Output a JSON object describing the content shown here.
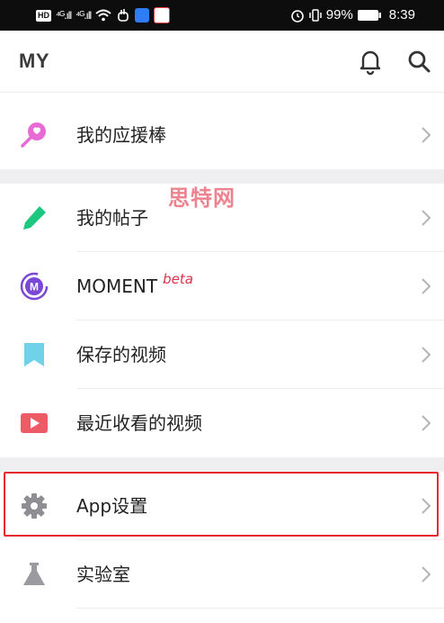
{
  "status_bar": {
    "hd_badge": "HD",
    "signal1": "⁴ᴳ.ıll",
    "signal2": "⁴ᴳ.ıll",
    "battery": "99%",
    "time": "8:39"
  },
  "header": {
    "title": "MY"
  },
  "watermark": "思特网",
  "menu": {
    "cheer_stick": "我的应援棒",
    "my_posts": "我的帖子",
    "moment": "MOMENT",
    "moment_badge": "beta",
    "saved_videos": "保存的视频",
    "recent_videos": "最近收看的视频",
    "app_settings": "App设置",
    "lab": "实验室"
  },
  "colors": {
    "cheer_icon": "#e86ad4",
    "pencil_icon": "#1ec77f",
    "moment_icon": "#7b48d6",
    "bookmark_icon": "#6fd2e8",
    "play_icon": "#ec5b66",
    "gear_icon": "#8e8e93",
    "flask_icon": "#9a9aa0",
    "highlight": "#e8262d"
  }
}
